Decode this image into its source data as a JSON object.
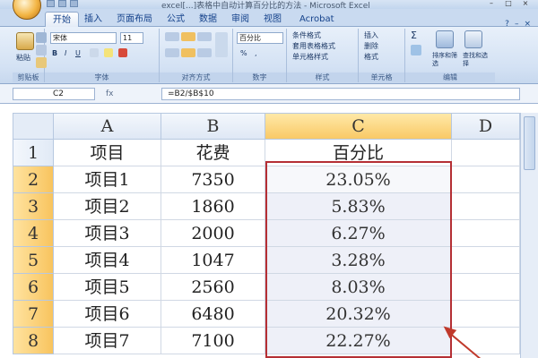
{
  "window": {
    "title": "excel[...]表格中自动计算百分比的方法 - Microsoft Excel",
    "controls": [
      "–",
      "□",
      "×"
    ]
  },
  "tabs": [
    "开始",
    "插入",
    "页面布局",
    "公式",
    "数据",
    "审阅",
    "视图",
    "Acrobat"
  ],
  "active_tab": "开始",
  "ribbon": {
    "clipboard": {
      "label": "剪贴板",
      "paste": "粘贴"
    },
    "font": {
      "label": "字体",
      "font_name": "宋体",
      "font_size": "11",
      "bold": "B",
      "italic": "I",
      "underline": "U"
    },
    "alignment": {
      "label": "对齐方式"
    },
    "number": {
      "label": "数字",
      "format": "百分比",
      "percent": "%",
      "comma": ","
    },
    "styles": {
      "label": "样式",
      "conditional": "条件格式",
      "table": "套用表格格式",
      "cell": "单元格样式"
    },
    "cells": {
      "label": "单元格",
      "insert": "插入",
      "delete": "删除",
      "format": "格式"
    },
    "editing": {
      "label": "编辑",
      "sort": "排序和筛选",
      "find": "查找和选择",
      "sigma": "Σ"
    }
  },
  "formula_bar": {
    "name_box": "C2",
    "fx": "fx",
    "formula": "=B2/$B$10"
  },
  "columns": [
    "A",
    "B",
    "C",
    "D"
  ],
  "rows": [
    {
      "n": "1",
      "a": "项目",
      "b": "花费",
      "c": "百分比"
    },
    {
      "n": "2",
      "a": "项目1",
      "b": "7350",
      "c": "23.05%"
    },
    {
      "n": "3",
      "a": "项目2",
      "b": "1860",
      "c": "5.83%"
    },
    {
      "n": "4",
      "a": "项目3",
      "b": "2000",
      "c": "6.27%"
    },
    {
      "n": "5",
      "a": "项目4",
      "b": "1047",
      "c": "3.28%"
    },
    {
      "n": "6",
      "a": "项目5",
      "b": "2560",
      "c": "8.03%"
    },
    {
      "n": "7",
      "a": "项目6",
      "b": "6480",
      "c": "20.32%"
    },
    {
      "n": "8",
      "a": "项目7",
      "b": "7100",
      "c": "22.27%"
    }
  ],
  "colors": {
    "selection_border": "#b52f34",
    "ribbon": "#d4e2f4",
    "tab_text": "#15428b"
  }
}
